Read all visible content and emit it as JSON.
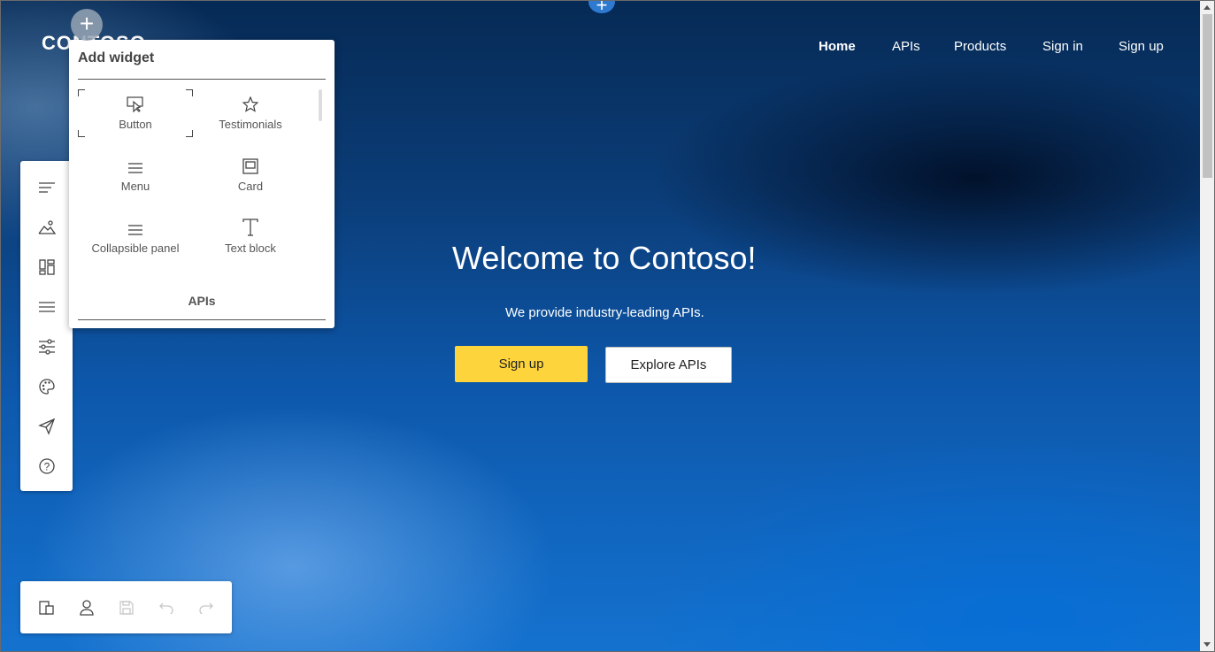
{
  "site": {
    "logo_text": "CONTOSO",
    "nav": [
      "Home",
      "APIs",
      "Products",
      "Sign in",
      "Sign up"
    ]
  },
  "hero": {
    "title": "Welcome to Contoso!",
    "subtitle": "We provide industry-leading APIs.",
    "primary_button": "Sign up",
    "secondary_button": "Explore APIs"
  },
  "add_widget_panel": {
    "title": "Add widget",
    "widgets": [
      {
        "label": "Button",
        "icon": "cursor-click-icon"
      },
      {
        "label": "Testimonials",
        "icon": "star-icon"
      },
      {
        "label": "Menu",
        "icon": "menu-lines-icon"
      },
      {
        "label": "Card",
        "icon": "card-icon"
      },
      {
        "label": "Collapsible panel",
        "icon": "menu-lines-icon"
      },
      {
        "label": "Text block",
        "icon": "text-t-icon"
      }
    ],
    "section": "APIs"
  },
  "left_toolbar": {
    "icons": [
      "text-lines-icon",
      "image-icon",
      "layout-icon",
      "menu-icon",
      "settings-sliders-icon",
      "palette-icon",
      "publish-icon",
      "help-icon"
    ]
  },
  "bottom_toolbar": {
    "icons": [
      "devices-icon",
      "user-icon",
      "save-icon",
      "undo-icon",
      "redo-icon"
    ]
  },
  "colors": {
    "accent_yellow": "#fdd43b",
    "plus_blue": "#2e7ad1"
  }
}
